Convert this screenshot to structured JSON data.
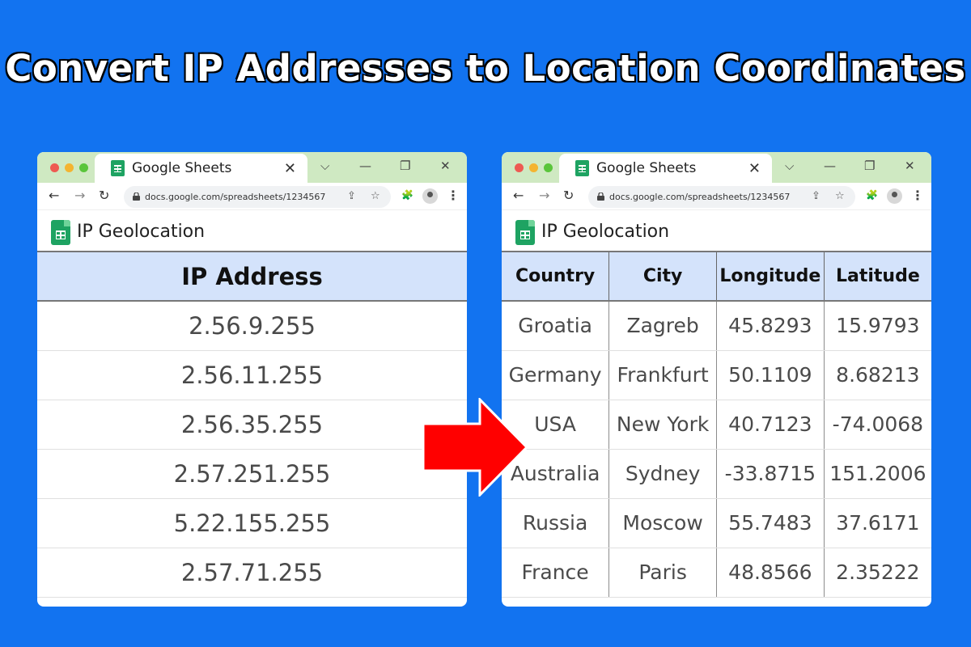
{
  "headline": "Convert IP Addresses to Location Coordinates",
  "browser": {
    "tab_title": "Google Sheets",
    "url": "docs.google.com/spreadsheets/1234567",
    "doc_title": "IP Geolocation"
  },
  "left_sheet": {
    "header": "IP Address",
    "rows": [
      "2.56.9.255",
      "2.56.11.255",
      "2.56.35.255",
      "2.57.251.255",
      "5.22.155.255",
      "2.57.71.255"
    ]
  },
  "right_sheet": {
    "headers": [
      "Country",
      "City",
      "Longitude",
      "Latitude"
    ],
    "rows": [
      [
        "Groatia",
        "Zagreb",
        "45.8293",
        "15.9793"
      ],
      [
        "Germany",
        "Frankfurt",
        "50.1109",
        "8.68213"
      ],
      [
        "USA",
        "New York",
        "40.7123",
        "-74.0068"
      ],
      [
        "Australia",
        "Sydney",
        "-33.8715",
        "151.2006"
      ],
      [
        "Russia",
        "Moscow",
        "55.7483",
        "37.6171"
      ],
      [
        "France",
        "Paris",
        "48.8566",
        "2.35222"
      ]
    ]
  },
  "colors": {
    "background": "#1273f0",
    "tab_bar": "#cfe9c2",
    "header_fill": "#d4e3fb",
    "arrow": "#ff0000",
    "sheets_green": "#1ea362"
  },
  "icons": [
    "close-icon",
    "chevron-down-icon",
    "minimize-icon",
    "restore-icon",
    "back-arrow-icon",
    "forward-arrow-icon",
    "reload-icon",
    "lock-icon",
    "share-icon",
    "star-icon",
    "extensions-icon",
    "profile-icon",
    "more-vert-icon",
    "google-sheets-icon",
    "right-arrow-icon"
  ]
}
